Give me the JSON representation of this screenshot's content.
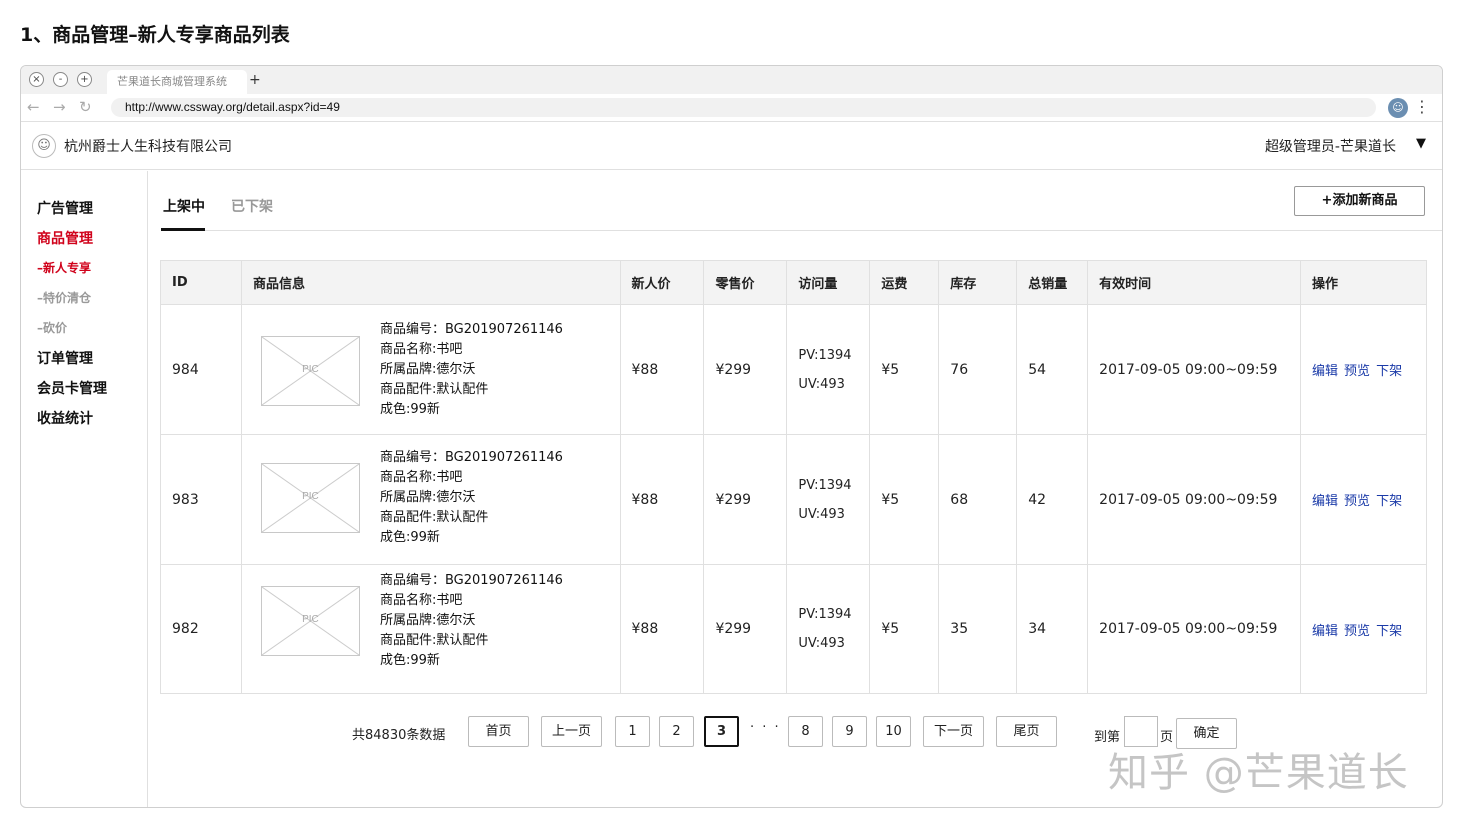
{
  "page_heading": "1、商品管理–新人专享商品列表",
  "browser": {
    "tab_title": "芒果道长商城管理系统",
    "new_tab": "+",
    "url": "http://www.cssway.org/detail.aspx?id=49",
    "close": "×",
    "minimize": "-",
    "maximize": "+",
    "back": "←",
    "forward": "→",
    "reload": "↻",
    "menu": "⋮",
    "avatar_glyph": "☺"
  },
  "header": {
    "logo_glyph": "☺",
    "company": "杭州爵士人生科技有限公司",
    "user": "超级管理员-芒果道长",
    "caret": "▼"
  },
  "sidebar": {
    "items": [
      {
        "label": "广告管理"
      },
      {
        "label": "商品管理"
      },
      {
        "label": "–新人专享"
      },
      {
        "label": "–特价清仓"
      },
      {
        "label": "–砍价"
      },
      {
        "label": "订单管理"
      },
      {
        "label": "会员卡管理"
      },
      {
        "label": "收益统计"
      }
    ]
  },
  "tabs": {
    "on_shelf": "上架中",
    "off_shelf": "已下架",
    "add_button": "+添加新商品"
  },
  "table": {
    "headers": [
      "ID",
      "商品信息",
      "新人价",
      "零售价",
      "访问量",
      "运费",
      "库存",
      "总销量",
      "有效时间",
      "操作"
    ],
    "pic_label": "PIC",
    "rows": [
      {
        "id": "984",
        "info": [
          "商品编号：BG201907261146",
          "商品名称:书吧",
          "所属品牌:德尔沃",
          "商品配件:默认配件",
          "成色:99新"
        ],
        "new_price": "¥88",
        "retail_price": "¥299",
        "pv": "PV:1394",
        "uv": "UV:493",
        "shipping": "¥5",
        "stock": "76",
        "sales": "54",
        "valid_time": "2017-09-05 09:00~09:59",
        "actions": [
          "编辑",
          "预览",
          "下架"
        ]
      },
      {
        "id": "983",
        "info": [
          "商品编号：BG201907261146",
          "商品名称:书吧",
          "所属品牌:德尔沃",
          "商品配件:默认配件",
          "成色:99新"
        ],
        "new_price": "¥88",
        "retail_price": "¥299",
        "pv": "PV:1394",
        "uv": "UV:493",
        "shipping": "¥5",
        "stock": "68",
        "sales": "42",
        "valid_time": "2017-09-05 09:00~09:59",
        "actions": [
          "编辑",
          "预览",
          "下架"
        ]
      },
      {
        "id": "982",
        "info": [
          "商品编号：BG201907261146",
          "商品名称:书吧",
          "所属品牌:德尔沃",
          "商品配件:默认配件",
          "成色:99新"
        ],
        "new_price": "¥88",
        "retail_price": "¥299",
        "pv": "PV:1394",
        "uv": "UV:493",
        "shipping": "¥5",
        "stock": "35",
        "sales": "34",
        "valid_time": "2017-09-05 09:00~09:59",
        "actions": [
          "编辑",
          "预览",
          "下架"
        ]
      }
    ]
  },
  "pagination": {
    "total": "共84830条数据",
    "first": "首页",
    "prev": "上一页",
    "pages": [
      "1",
      "2",
      "3",
      "8",
      "9",
      "10"
    ],
    "current": "3",
    "ellipsis": "· · ·",
    "next": "下一页",
    "last": "尾页",
    "goto_prefix": "到第",
    "goto_suffix": "页",
    "confirm": "确定"
  },
  "watermark": "知乎 @芒果道长",
  "colors": {
    "active_red": "#d0021b",
    "link_blue": "#1a3aa8"
  }
}
